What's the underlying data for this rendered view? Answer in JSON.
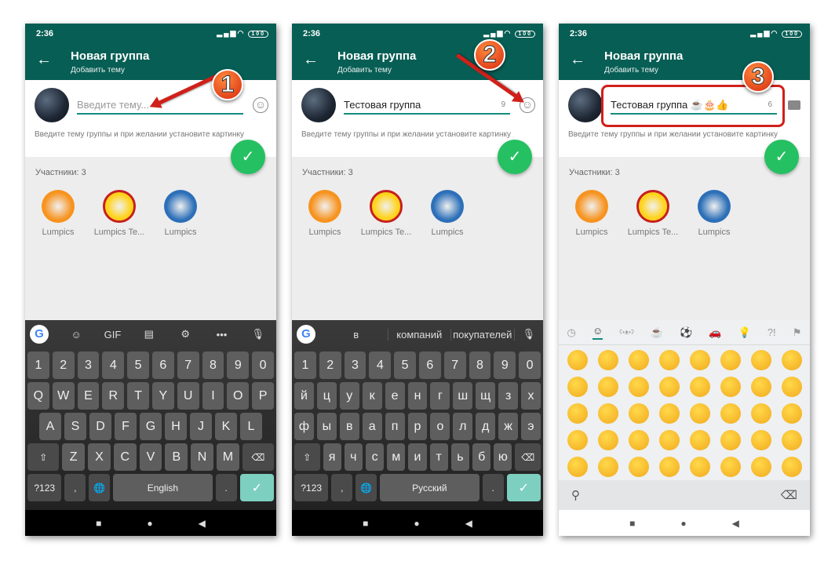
{
  "status": {
    "time": "2:36",
    "battery": "100"
  },
  "appbar": {
    "title": "Новая группа",
    "subtitle": "Добавить тему"
  },
  "hint": "Введите тему группы и при желании установите картинку",
  "participants_label": "Участники: 3",
  "members": [
    {
      "name": "Lumpics",
      "color": "#f7931e"
    },
    {
      "name": "Lumpics Te...",
      "color": "#ffd31a"
    },
    {
      "name": "Lumpics",
      "color": "#2c6fb8"
    }
  ],
  "panels": [
    {
      "step": "1",
      "field": {
        "placeholder": "Введите тему...",
        "value": "",
        "counter": ""
      },
      "field_icon": "emoji-icon",
      "keyboard": {
        "type": "latin",
        "suggestions": [
          "GIF"
        ],
        "toolbar": [
          "sticker-icon",
          "GIF",
          "clipboard-icon",
          "gear-icon",
          "more-icon",
          "mic-icon"
        ],
        "rows": [
          [
            "1",
            "2",
            "3",
            "4",
            "5",
            "6",
            "7",
            "8",
            "9",
            "0"
          ],
          [
            "Q",
            "W",
            "E",
            "R",
            "T",
            "Y",
            "U",
            "I",
            "O",
            "P"
          ],
          [
            "A",
            "S",
            "D",
            "F",
            "G",
            "H",
            "J",
            "K",
            "L"
          ],
          [
            "⇧",
            "Z",
            "X",
            "C",
            "V",
            "B",
            "N",
            "M",
            "⌫"
          ]
        ],
        "bottom": [
          "?123",
          ",",
          "🌐",
          "English",
          ".",
          "✓"
        ]
      }
    },
    {
      "step": "2",
      "field": {
        "placeholder": "",
        "value": "Тестовая группа",
        "counter": "9"
      },
      "field_icon": "emoji-icon",
      "keyboard": {
        "type": "cyrillic",
        "suggestions": [
          "в",
          "компаний",
          "покупателей"
        ],
        "rows": [
          [
            "1",
            "2",
            "3",
            "4",
            "5",
            "6",
            "7",
            "8",
            "9",
            "0"
          ],
          [
            "й",
            "ц",
            "у",
            "к",
            "е",
            "н",
            "г",
            "ш",
            "щ",
            "з",
            "х"
          ],
          [
            "ф",
            "ы",
            "в",
            "а",
            "п",
            "р",
            "о",
            "л",
            "д",
            "ж",
            "э"
          ],
          [
            "⇧",
            "я",
            "ч",
            "с",
            "м",
            "и",
            "т",
            "ь",
            "б",
            "ю",
            "⌫"
          ]
        ],
        "bottom": [
          "?123",
          ",",
          "🌐",
          "Русский",
          ".",
          "✓"
        ]
      }
    },
    {
      "step": "3",
      "field": {
        "placeholder": "",
        "value": "Тестовая группа ☕🎂👍",
        "counter": "6"
      },
      "field_icon": "keyboard-icon",
      "emoji_keyboard": {
        "tabs": [
          "recent-icon",
          "smiley-icon",
          "animal-icon",
          "food-icon",
          "sport-icon",
          "travel-icon",
          "objects-icon",
          "symbols-icon",
          "flag-icon"
        ],
        "selected_tab": 1,
        "count": 40
      }
    }
  ],
  "nav": [
    "■",
    "●",
    "◀"
  ],
  "colors": {
    "header": "#075e54",
    "accent": "#128c7e",
    "fab": "#25c062",
    "callout": "#d0201a"
  }
}
